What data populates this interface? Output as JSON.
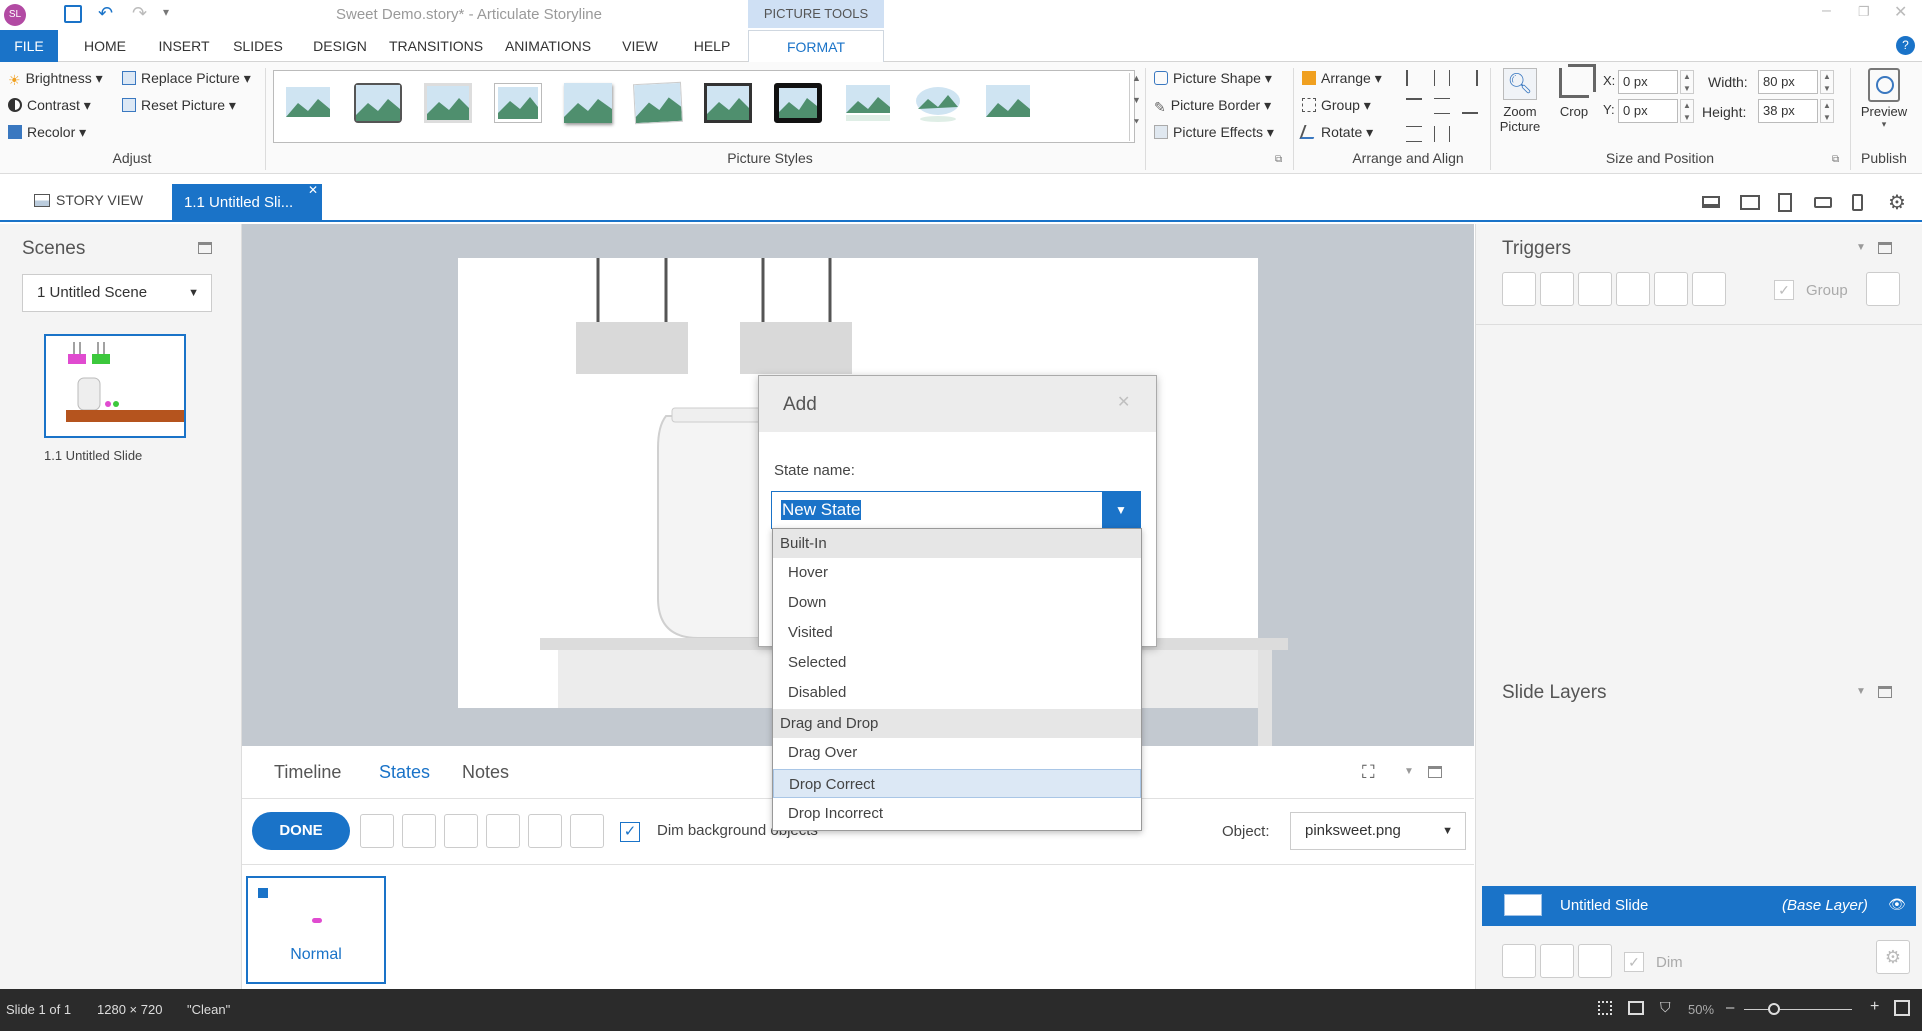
{
  "app": {
    "document": "Sweet Demo.story*",
    "separator": "-",
    "app_name": "Articulate Storyline",
    "contextual_tab": "PICTURE TOOLS",
    "logo": "SL"
  },
  "ribbon_tabs": [
    "FILE",
    "HOME",
    "INSERT",
    "SLIDES",
    "DESIGN",
    "TRANSITIONS",
    "ANIMATIONS",
    "VIEW",
    "HELP",
    "FORMAT"
  ],
  "adjust": {
    "brightness": "Brightness",
    "contrast": "Contrast",
    "recolor": "Recolor",
    "replace_picture": "Replace Picture",
    "reset_picture": "Reset Picture",
    "group_label": "Adjust"
  },
  "picture_styles": {
    "group_label": "Picture Styles"
  },
  "picture_shape": {
    "shape": "Picture Shape",
    "border": "Picture Border",
    "effects": "Picture Effects"
  },
  "arrange": {
    "arrange": "Arrange",
    "group": "Group",
    "rotate": "Rotate",
    "group_label": "Arrange and Align"
  },
  "size_position": {
    "zoom": "Zoom",
    "picture": "Picture",
    "crop": "Crop",
    "x_label": "X:",
    "x_value": "0 px",
    "y_label": "Y:",
    "y_value": "0 px",
    "width_label": "Width:",
    "width_value": "80 px",
    "height_label": "Height:",
    "height_value": "38 px",
    "group_label": "Size and Position"
  },
  "publish": {
    "preview": "Preview",
    "group_label": "Publish"
  },
  "doc_tabs": {
    "story_view": "STORY VIEW",
    "slide_tab": "1.1 Untitled Sli..."
  },
  "scenes": {
    "title": "Scenes",
    "selected_scene": "1 Untitled Scene",
    "slide_label": "1.1 Untitled Slide"
  },
  "triggers": {
    "title": "Triggers",
    "group": "Group"
  },
  "slide_layers": {
    "title": "Slide Layers",
    "base_name": "Untitled Slide",
    "base_tag": "(Base Layer)",
    "dim": "Dim"
  },
  "bottom_panel": {
    "tabs": [
      "Timeline",
      "States",
      "Notes"
    ],
    "active_tab": "States",
    "done": "DONE",
    "dim_bg": "Dim background objects",
    "object_label": "Object:",
    "object_value": "pinksweet.png",
    "state_name": "Normal"
  },
  "dialog": {
    "title": "Add",
    "state_name_label": "State name:",
    "state_name_value": "New State",
    "groups": [
      {
        "header": "Built-In",
        "items": [
          "Hover",
          "Down",
          "Visited",
          "Selected",
          "Disabled"
        ]
      },
      {
        "header": "Drag and Drop",
        "items": [
          "Drag Over",
          "Drop Correct",
          "Drop Incorrect"
        ]
      }
    ],
    "highlighted": "Drop Correct"
  },
  "status": {
    "slide": "Slide 1 of 1",
    "size": "1280 × 720",
    "theme": "\"Clean\"",
    "zoom": "50%"
  },
  "colors": {
    "accent": "#1a73c8",
    "status_bg": "#2b2b2b"
  }
}
